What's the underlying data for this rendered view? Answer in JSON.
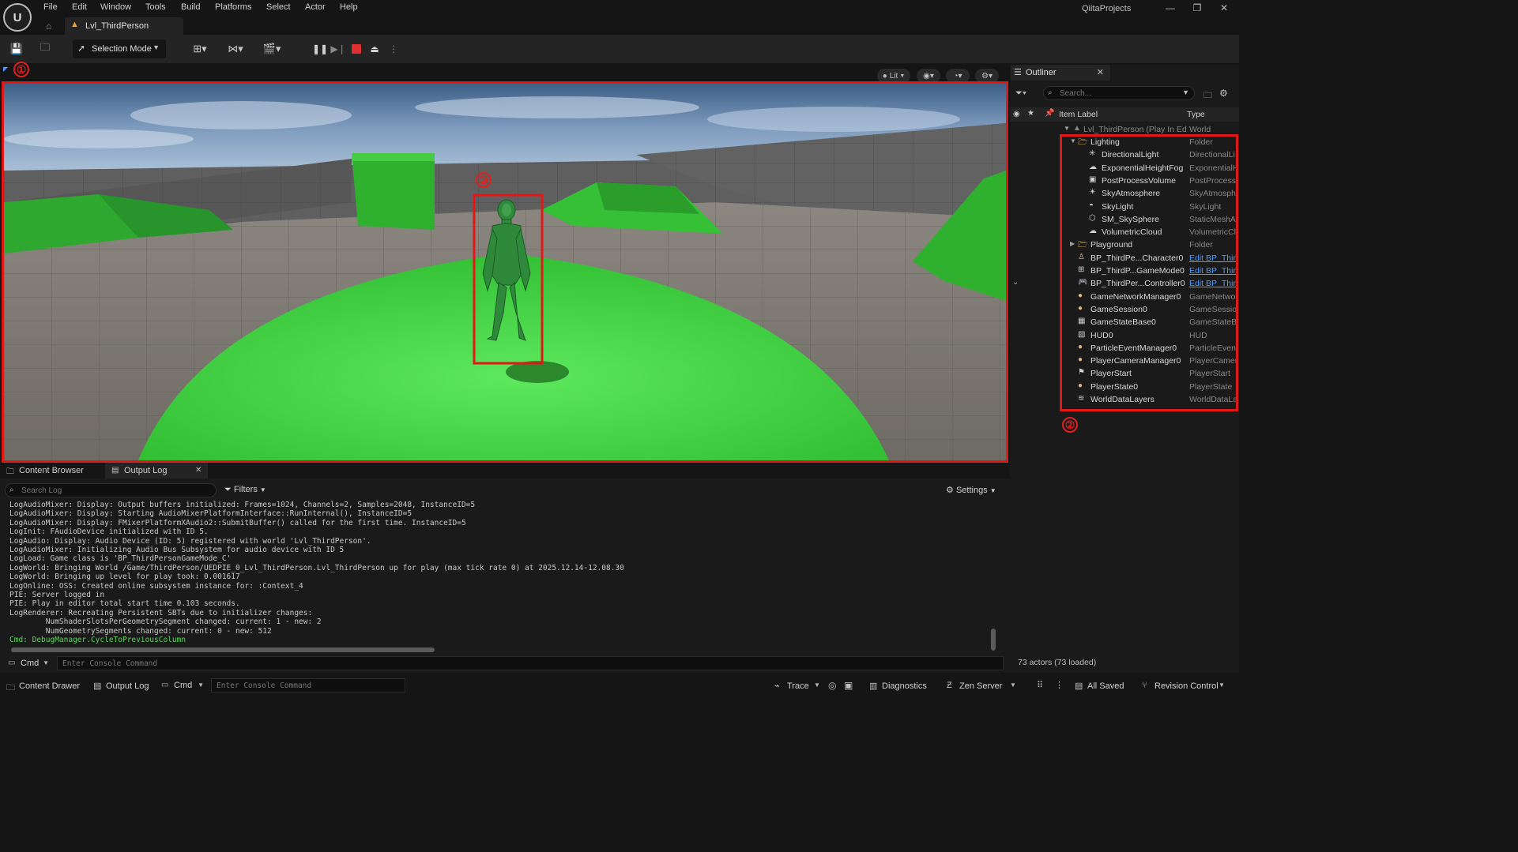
{
  "app": {
    "project": "QiitaProjects",
    "level_tab": "Lvl_ThirdPerson",
    "logo": "U"
  },
  "menu": [
    "File",
    "Edit",
    "Window",
    "Tools",
    "Build",
    "Platforms",
    "Select",
    "Actor",
    "Help"
  ],
  "toolbar": {
    "selection_mode": "Selection Mode"
  },
  "viewport": {
    "view_mode": "Lit",
    "annotations": [
      "①",
      "③"
    ]
  },
  "outliner": {
    "title": "Outliner",
    "search_placeholder": "Search...",
    "col_label": "Item Label",
    "col_type": "Type",
    "annotation": "②",
    "world_row": {
      "label": "Lvl_ThirdPerson (Play In Ed",
      "type": "World"
    },
    "items": [
      {
        "label": "Lighting",
        "type": "Folder",
        "icon": "folder-icon",
        "indent": 1,
        "expanded": true,
        "link": false
      },
      {
        "label": "DirectionalLight",
        "type": "DirectionalLi",
        "icon": "directional-light-icon",
        "indent": 2,
        "link": false
      },
      {
        "label": "ExponentialHeightFog",
        "type": "ExponentialH",
        "icon": "fog-icon",
        "indent": 2,
        "link": false
      },
      {
        "label": "PostProcessVolume",
        "type": "PostProcess",
        "icon": "volume-icon",
        "indent": 2,
        "link": false
      },
      {
        "label": "SkyAtmosphere",
        "type": "SkyAtmosph",
        "icon": "atmosphere-icon",
        "indent": 2,
        "link": false
      },
      {
        "label": "SkyLight",
        "type": "SkyLight",
        "icon": "skylight-icon",
        "indent": 2,
        "link": false
      },
      {
        "label": "SM_SkySphere",
        "type": "StaticMeshA",
        "icon": "mesh-icon",
        "indent": 2,
        "link": false
      },
      {
        "label": "VolumetricCloud",
        "type": "VolumetricCl",
        "icon": "cloud-icon",
        "indent": 2,
        "link": false
      },
      {
        "label": "Playground",
        "type": "Folder",
        "icon": "folder-icon",
        "indent": 1,
        "expanded": false,
        "link": false
      },
      {
        "label": "BP_ThirdPe...Character0",
        "type": "Edit BP_Thir",
        "icon": "pawn-icon",
        "indent": 1,
        "link": true
      },
      {
        "label": "BP_ThirdP...GameMode0",
        "type": "Edit BP_Thir",
        "icon": "gamemode-icon",
        "indent": 1,
        "link": true
      },
      {
        "label": "BP_ThirdPer...Controller0",
        "type": "Edit BP_Thir",
        "icon": "controller-icon",
        "indent": 1,
        "link": true
      },
      {
        "label": "GameNetworkManager0",
        "type": "GameNetwo",
        "icon": "actor-icon",
        "indent": 1,
        "link": false
      },
      {
        "label": "GameSession0",
        "type": "GameSessio",
        "icon": "actor-icon",
        "indent": 1,
        "link": false
      },
      {
        "label": "GameStateBase0",
        "type": "GameStateB",
        "icon": "gamestate-icon",
        "indent": 1,
        "link": false
      },
      {
        "label": "HUD0",
        "type": "HUD",
        "icon": "hud-icon",
        "indent": 1,
        "link": false
      },
      {
        "label": "ParticleEventManager0",
        "type": "ParticleEven",
        "icon": "actor-icon",
        "indent": 1,
        "link": false
      },
      {
        "label": "PlayerCameraManager0",
        "type": "PlayerCamer",
        "icon": "actor-icon",
        "indent": 1,
        "link": false
      },
      {
        "label": "PlayerStart",
        "type": "PlayerStart",
        "icon": "playerstart-icon",
        "indent": 1,
        "link": false
      },
      {
        "label": "PlayerState0",
        "type": "PlayerState",
        "icon": "actor-icon",
        "indent": 1,
        "link": false
      },
      {
        "label": "WorldDataLayers",
        "type": "WorldDataLa",
        "icon": "layers-icon",
        "indent": 1,
        "link": false
      }
    ],
    "actors_count": "73 actors (73 loaded)"
  },
  "bottom": {
    "tab_content_browser": "Content Browser",
    "tab_output_log": "Output Log",
    "search_placeholder": "Search Log",
    "filters": "Filters",
    "settings": "Settings",
    "log_lines": [
      "LogAudioMixer: Display: Output buffers initialized: Frames=1024, Channels=2, Samples=2048, InstanceID=5",
      "LogAudioMixer: Display: Starting AudioMixerPlatformInterface::RunInternal(), InstanceID=5",
      "LogAudioMixer: Display: FMixerPlatformXAudio2::SubmitBuffer() called for the first time. InstanceID=5",
      "LogInit: FAudioDevice initialized with ID 5.",
      "LogAudio: Display: Audio Device (ID: 5) registered with world 'Lvl_ThirdPerson'.",
      "LogAudioMixer: Initializing Audio Bus Subsystem for audio device with ID 5",
      "LogLoad: Game class is 'BP_ThirdPersonGameMode_C'",
      "LogWorld: Bringing World /Game/ThirdPerson/UEDPIE_0_Lvl_ThirdPerson.Lvl_ThirdPerson up for play (max tick rate 0) at 2025.12.14-12.08.30",
      "LogWorld: Bringing up level for play took: 0.001617",
      "LogOnline: OSS: Created online subsystem instance for: :Context_4",
      "PIE: Server logged in",
      "PIE: Play in editor total start time 0.103 seconds.",
      "LogRenderer: Recreating Persistent SBTs due to initializer changes:",
      "        NumShaderSlotsPerGeometrySegment changed: current: 1 - new: 2",
      "        NumGeometrySegments changed: current: 0 - new: 512"
    ],
    "cmd_line": "Cmd: DebugManager.CycleToPreviousColumn",
    "cmd_label": "Cmd",
    "console_placeholder": "Enter Console Command"
  },
  "status": {
    "content_drawer": "Content Drawer",
    "output_log": "Output Log",
    "cmd": "Cmd",
    "console_placeholder": "Enter Console Command",
    "trace": "Trace",
    "diagnostics": "Diagnostics",
    "zen_server": "Zen Server",
    "all_saved": "All Saved",
    "revision_control": "Revision Control"
  },
  "colors": {
    "annotation_red": "#e01818",
    "floor_green": "#42d442",
    "link_blue": "#4a9bff",
    "log_cmd_green": "#62d262"
  }
}
